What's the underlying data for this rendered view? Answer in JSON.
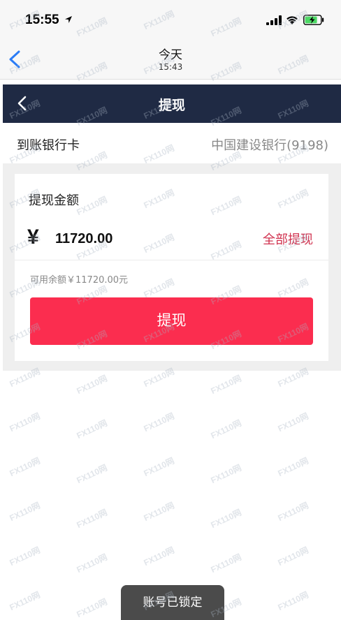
{
  "status_bar": {
    "time": "15:55"
  },
  "top_header": {
    "title": "今天",
    "subtitle": "15:43"
  },
  "nav": {
    "title": "提现"
  },
  "bank": {
    "label": "到账银行卡",
    "value": "中国建设银行(9198)"
  },
  "withdraw": {
    "title": "提现金额",
    "currency_symbol": "¥",
    "amount_value": "11720.00",
    "all_label": "全部提现",
    "available_text": "可用余额￥11720.00元",
    "submit_label": "提现"
  },
  "toast": {
    "text": "账号已锁定"
  },
  "watermark": {
    "text": "FX110网"
  },
  "colors": {
    "nav_bg": "#1f2a44",
    "accent_red": "#fb2d4f",
    "link_red": "#d0324f",
    "ios_blue": "#2b7cf6"
  }
}
